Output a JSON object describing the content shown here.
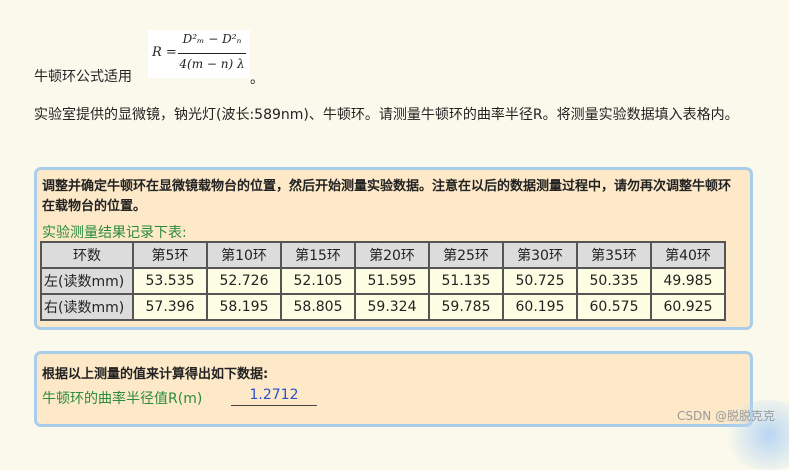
{
  "formula": {
    "prefix": "牛顿环公式适用",
    "lhs": "R =",
    "numerator": "D²ₘ − D²ₙ",
    "denominator": "4(m − n) λ",
    "suffix": "。"
  },
  "intro": "实验室提供的显微镜，钠光灯(波长:589nm)、牛顿环。请测量牛顿环的曲率半径R。将测量实验数据填入表格内。",
  "panel1": {
    "instruction": "调整并确定牛顿环在显微镜载物台的位置，然后开始测量实验数据。注意在以后的数据测量过程中，请勿再次调整牛顿环在载物台的位置。",
    "caption": "实验测量结果记录下表:",
    "table": {
      "corner": "环数",
      "headers": [
        "第5环",
        "第10环",
        "第15环",
        "第20环",
        "第25环",
        "第30环",
        "第35环",
        "第40环"
      ],
      "rows": [
        {
          "label": "左(读数mm)",
          "values": [
            "53.535",
            "52.726",
            "52.105",
            "51.595",
            "51.135",
            "50.725",
            "50.335",
            "49.985"
          ]
        },
        {
          "label": "右(读数mm)",
          "values": [
            "57.396",
            "58.195",
            "58.805",
            "59.324",
            "59.785",
            "60.195",
            "60.575",
            "60.925"
          ]
        }
      ]
    }
  },
  "panel2": {
    "title": "根据以上测量的值来计算得出如下数据:",
    "label": "牛顿环的曲率半径值R(m)",
    "value": "1.2712"
  },
  "watermark": "CSDN @脱脱克克"
}
